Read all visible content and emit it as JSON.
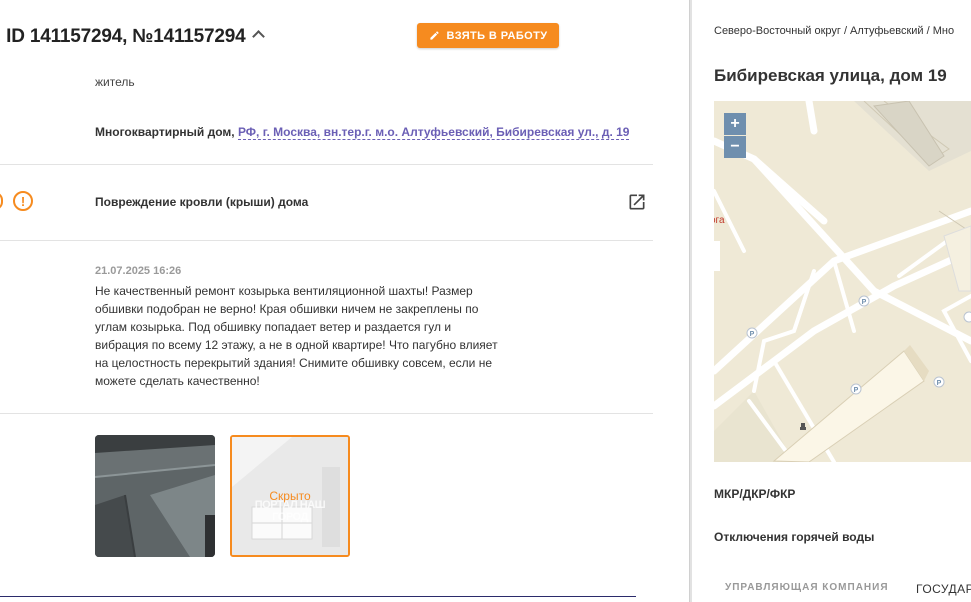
{
  "header": {
    "title": ", ID 141157294, №141157294",
    "take_button_label": "ВЗЯТЬ В РАБОТУ"
  },
  "applicant": {
    "role": "житель"
  },
  "object": {
    "type_label": "Многоквартирный дом, ",
    "address_link": "РФ, г. Москва, вн.тер.г. м.о. Алтуфьевский, Бибиревская ул., д. 19"
  },
  "issue": {
    "warning_icon_glyph": "!",
    "title": "Повреждение кровли (крыши) дома"
  },
  "comment": {
    "date": "21.07.2025 16:26",
    "text": "Не качественный ремонт козырька вентиляционной шахты! Размер обшивки подобран не верно! Края обшивки ничем не закреплены по углам козырька. Под обшивку попадает ветер и раздается гул и вибрация по всему 12 этажу, а не в одной квартире! Что пагубно влияет на целостность перекрытий здания! Снимите обшивку совсем, если не можете сделать качественно!"
  },
  "photos": {
    "hidden_label": "Скрыто",
    "watermark": "ПОРТАЛ НАШ ГОРОД"
  },
  "right_panel": {
    "breadcrumb": "Северо-Восточный округ / Алтуфьевский / Мно",
    "address": "Бибиревская улица, дом 19",
    "map": {
      "zoom_in": "+",
      "zoom_out": "−",
      "fragment_text": "ога",
      "parking_glyph": "P"
    },
    "label_mkr": "МКР/ДКР/ФКР",
    "label_hot_water": "Отключения горячей воды",
    "tab_management": "УПРАВЛЯЮЩАЯ КОМПАНИЯ",
    "tab_state": "ГОСУДАР"
  },
  "colors": {
    "accent": "#f68b1f",
    "link": "#6b5fb5",
    "zoom_button": "#6f8fae",
    "map_background": "#efe9d6"
  },
  "icons": {
    "pencil": "pencil-icon",
    "caret": "chevron-up-icon",
    "warning": "warning-icon",
    "external": "open-in-new-icon",
    "parking": "parking-icon",
    "monument": "monument-icon"
  }
}
